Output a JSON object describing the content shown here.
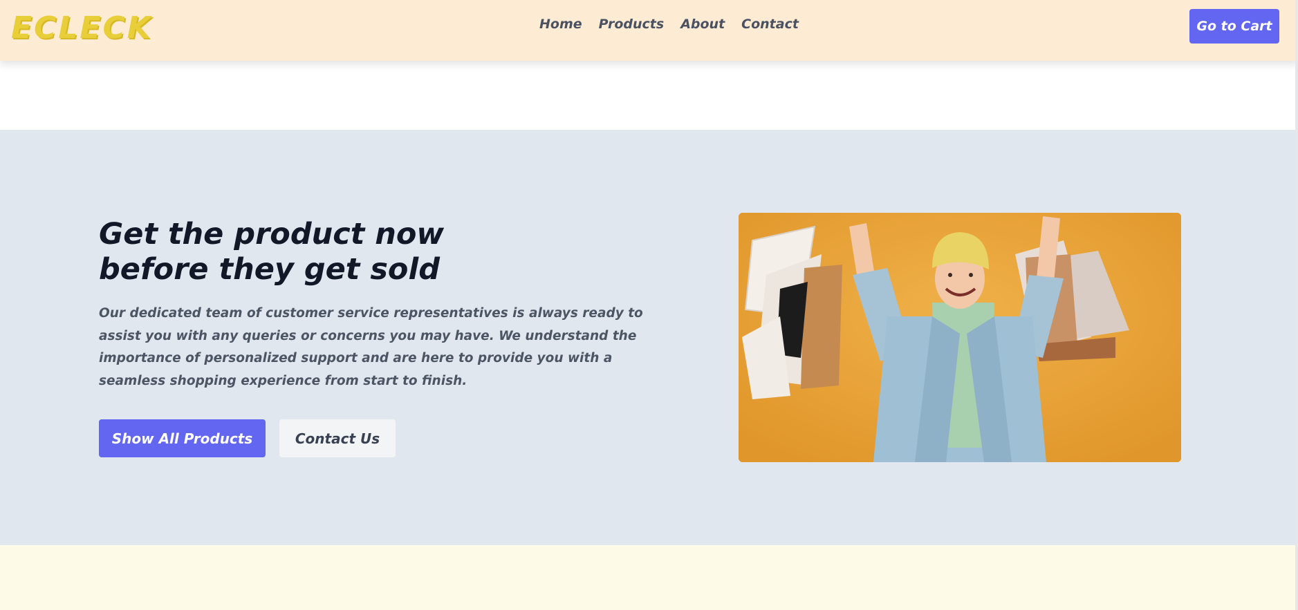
{
  "header": {
    "logo_text": "ECLECK",
    "nav": [
      "Home",
      "Products",
      "About",
      "Contact"
    ],
    "cart_button": "Go to Cart"
  },
  "hero": {
    "title": "Get the product now before they get sold",
    "description": "Our dedicated team of customer service representatives is always ready to assist you with any queries or concerns you may have. We understand the importance of personalized support and are here to provide you with a seamless shopping experience from start to finish.",
    "primary_button": "Show All Products",
    "secondary_button": "Contact Us",
    "image_icon": "shopping-woman-photo"
  },
  "colors": {
    "header_bg": "#feebd4",
    "accent": "#6366f1",
    "hero_bg": "#e1e7ef",
    "logo": "#e8cf3a",
    "bottom_band": "#fefae8"
  }
}
